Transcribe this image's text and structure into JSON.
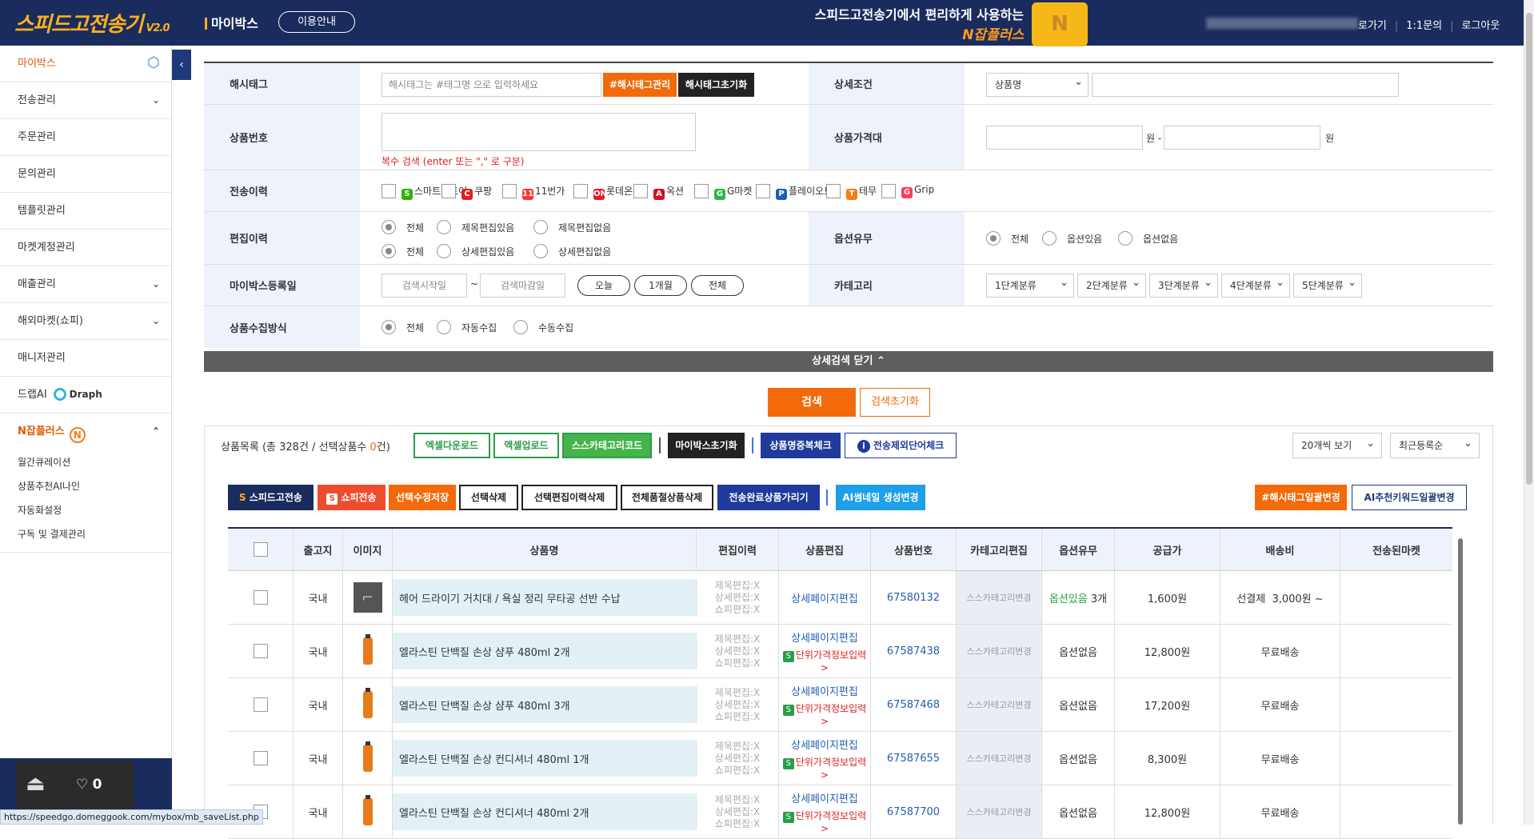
{
  "header": {
    "logo_text": "스피드고전송기",
    "logo_version": "V2.0",
    "section_title": "마이박스",
    "guide_button": "이용안내",
    "promo_line1": "스피드고전송기에서 편리하게 사용하는",
    "promo_line2": "N잡플러스",
    "links": [
      "로가기",
      "1:1문의",
      "로그아웃"
    ]
  },
  "sidebar": {
    "items": [
      {
        "label": "마이박스",
        "active": true,
        "icon": "cube-icon"
      },
      {
        "label": "전송관리",
        "chevron": "down"
      },
      {
        "label": "주문관리"
      },
      {
        "label": "문의관리"
      },
      {
        "label": "템플릿관리"
      },
      {
        "label": "마켓계정관리"
      },
      {
        "label": "매출관리",
        "chevron": "down"
      },
      {
        "label": "해외마켓(쇼피)",
        "chevron": "down"
      },
      {
        "label": "매니저관리"
      },
      {
        "label": "드랩AI",
        "extra": "Draph"
      },
      {
        "label": "N잡플러스",
        "chevron": "up"
      }
    ],
    "sub_items": [
      "월간큐레이션",
      "상품추천AI나인",
      "자동화설정",
      "구독 및 결제관리"
    ],
    "bubble_count": "0"
  },
  "status_url": "https://speedgo.domeggook.com/mybox/mb_saveList.php",
  "filters": {
    "hashtag_label": "해시태그",
    "hashtag_placeholder": "해시태그는 #태그명 으로 입력하세요",
    "hashtag_manage": "#해시태그관리",
    "hashtag_reset": "해시태그초기화",
    "detail_label": "상세조건",
    "detail_select": "상품명",
    "product_no_label": "상품번호",
    "product_no_hint": "복수 검색 (enter 또는 \",\" 로 구분)",
    "price_label": "상품가격대",
    "price_unit1": "원 -",
    "price_unit2": "원",
    "history_label": "전송이력",
    "markets": [
      {
        "name": "스마트스토어",
        "icon": "S",
        "color": "#2db400"
      },
      {
        "name": "쿠팡",
        "icon": "C",
        "color": "#e02020"
      },
      {
        "name": "11번가",
        "icon": "11",
        "color": "#ff3333"
      },
      {
        "name": "롯데온",
        "icon": "ON",
        "color": "#e0182d"
      },
      {
        "name": "옥션",
        "icon": "A",
        "color": "#d01020"
      },
      {
        "name": "G마켓",
        "icon": "G",
        "color": "#2fb44a"
      },
      {
        "name": "플레이오토",
        "icon": "P",
        "color": "#1f5fb5"
      },
      {
        "name": "테무",
        "icon": "T",
        "color": "#f57c12"
      },
      {
        "name": "Grip",
        "icon": "G",
        "color": "#ff3b5a"
      }
    ],
    "edit_label": "편집이력",
    "edit_row1": [
      "전체",
      "제목편집있음",
      "제목편집없음"
    ],
    "edit_row2": [
      "전체",
      "상세편집있음",
      "상세편집없음"
    ],
    "option_label": "옵션유무",
    "option_choices": [
      "전체",
      "옵션있음",
      "옵션없음"
    ],
    "reg_label": "마이박스등록일",
    "reg_start": "검색시작일",
    "reg_tilde": "~",
    "reg_end": "검색마감일",
    "reg_pills": [
      "오늘",
      "1개월",
      "전체"
    ],
    "category_label": "카테고리",
    "categories": [
      "1단계분류",
      "2단계분류",
      "3단계분류",
      "4단계분류",
      "5단계분류"
    ],
    "collect_label": "상품수집방식",
    "collect_choices": [
      "전체",
      "자동수집",
      "수동수집"
    ],
    "close_detail": "상세검색 닫기 ⌃",
    "search_btn": "검색",
    "reset_btn": "검색초기화"
  },
  "list": {
    "title_prefix": "상품목록 (총 ",
    "total": "328",
    "title_mid": "건 / 선택상품수 ",
    "selected": "0",
    "title_suffix": "건)",
    "excel_download": "엑셀다운로드",
    "excel_upload": "엑셀업로드",
    "sca_code": "스스카테고리코드",
    "mybox_reset": "마이박스초기화",
    "dup_check": "상품명중복체크",
    "exclude_check": "전송제외단어체크",
    "per_page": "20개씩 보기",
    "sort": "최근등록순",
    "speedgo_send": "스피드고전송",
    "shopee_send": "쇼피전송",
    "save_selected": "선택수정저장",
    "delete_selected": "선택삭제",
    "delete_edit_history": "선택편집이력삭제",
    "delete_soldout": "전체품절상품삭제",
    "hide_sent": "전송완료상품가리기",
    "ai_thumb": "AI썸네일 생성변경",
    "hashtag_bulk": "#해시태그일괄변경",
    "ai_keyword": "AI추천키워드일괄변경"
  },
  "table": {
    "headers": [
      "출고지",
      "이미지",
      "상품명",
      "편집이력",
      "상품편집",
      "상품번호",
      "카테고리편집",
      "옵션유무",
      "공급가",
      "배송비",
      "전송된마켓"
    ],
    "rows": [
      {
        "origin": "국내",
        "name": "헤어 드라이기 거치대 / 욕실 정리 무타공 선반 수납",
        "history": [
          "제목편집:X",
          "상세편집:X",
          "쇼피편집:X"
        ],
        "edit": "상세페이지편집",
        "unit_price": "",
        "product_no": "67580132",
        "category": "스스카테고리변경",
        "option": "옵션있음",
        "option_count": "3개",
        "price": "1,600원",
        "shipping": "선결제  3,000원 ~",
        "markets": "",
        "image": "hanger"
      },
      {
        "origin": "국내",
        "name": "엘라스틴 단백질 손상 샴푸 480ml 2개",
        "history": [
          "제목편집:X",
          "상세편집:X",
          "쇼피편집:X"
        ],
        "edit": "상세페이지편집",
        "unit_price": "단위가격정보입력>",
        "product_no": "67587438",
        "category": "스스카테고리변경",
        "option": "옵션없음",
        "option_count": "",
        "price": "12,800원",
        "shipping": "무료배송",
        "markets": "",
        "image": "bottle"
      },
      {
        "origin": "국내",
        "name": "엘라스틴 단백질 손상 샴푸 480ml 3개",
        "history": [
          "제목편집:X",
          "상세편집:X",
          "쇼피편집:X"
        ],
        "edit": "상세페이지편집",
        "unit_price": "단위가격정보입력>",
        "product_no": "67587468",
        "category": "스스카테고리변경",
        "option": "옵션없음",
        "option_count": "",
        "price": "17,200원",
        "shipping": "무료배송",
        "markets": "",
        "image": "bottle"
      },
      {
        "origin": "국내",
        "name": "엘라스틴 단백질 손상 컨디셔너 480ml 1개",
        "history": [
          "제목편집:X",
          "상세편집:X",
          "쇼피편집:X"
        ],
        "edit": "상세페이지편집",
        "unit_price": "단위가격정보입력>",
        "product_no": "67587655",
        "category": "스스카테고리변경",
        "option": "옵션없음",
        "option_count": "",
        "price": "8,300원",
        "shipping": "무료배송",
        "markets": "",
        "image": "bottle"
      },
      {
        "origin": "국내",
        "name": "엘라스틴 단백질 손상 컨디셔너 480ml 2개",
        "history": [
          "제목편집:X",
          "상세편집:X",
          "쇼피편집:X"
        ],
        "edit": "상세페이지편집",
        "unit_price": "단위가격정보입력>",
        "product_no": "67587700",
        "category": "스스카테고리변경",
        "option": "옵션없음",
        "option_count": "",
        "price": "12,800원",
        "shipping": "무료배송",
        "markets": "",
        "image": "bottle"
      }
    ]
  },
  "colors": {
    "navy": "#1a2c5e",
    "orange": "#f26a0a",
    "green": "#2a9d4a",
    "blue": "#1f5fb5"
  }
}
